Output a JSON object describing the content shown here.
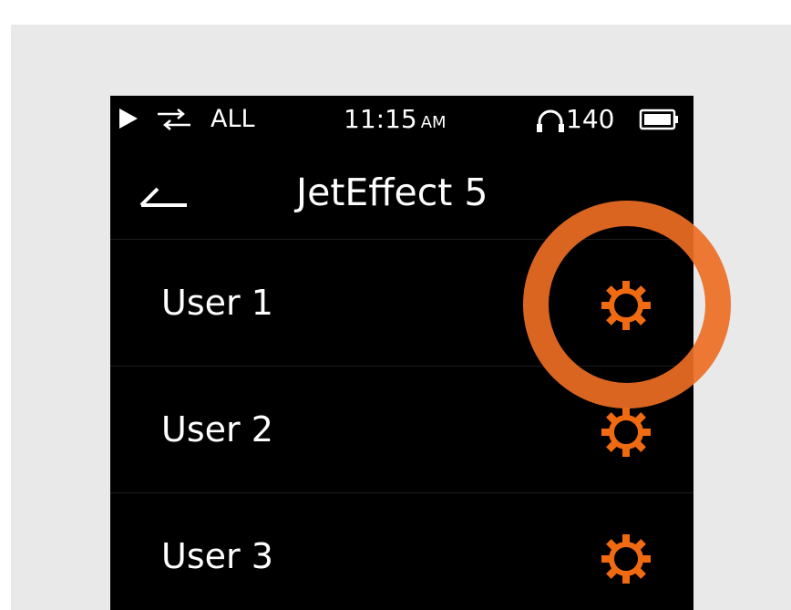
{
  "status_bar": {
    "repeat_mode": "ALL",
    "time": "11:15",
    "ampm": "AM",
    "volume": "140",
    "icons": [
      "play-icon",
      "repeat-icon",
      "headphone-icon",
      "battery-icon"
    ]
  },
  "header": {
    "back_icon": "back-icon",
    "title": "JetEffect 5"
  },
  "users": [
    {
      "label": "User 1",
      "icon": "gear-icon"
    },
    {
      "label": "User 2",
      "icon": "gear-icon"
    },
    {
      "label": "User 3",
      "icon": "gear-icon"
    }
  ],
  "colors": {
    "background": "#e9e9e9",
    "screen": "#000000",
    "text": "#ffffff",
    "accent": "#f06a12",
    "highlight_ring": "#ec6e24"
  }
}
